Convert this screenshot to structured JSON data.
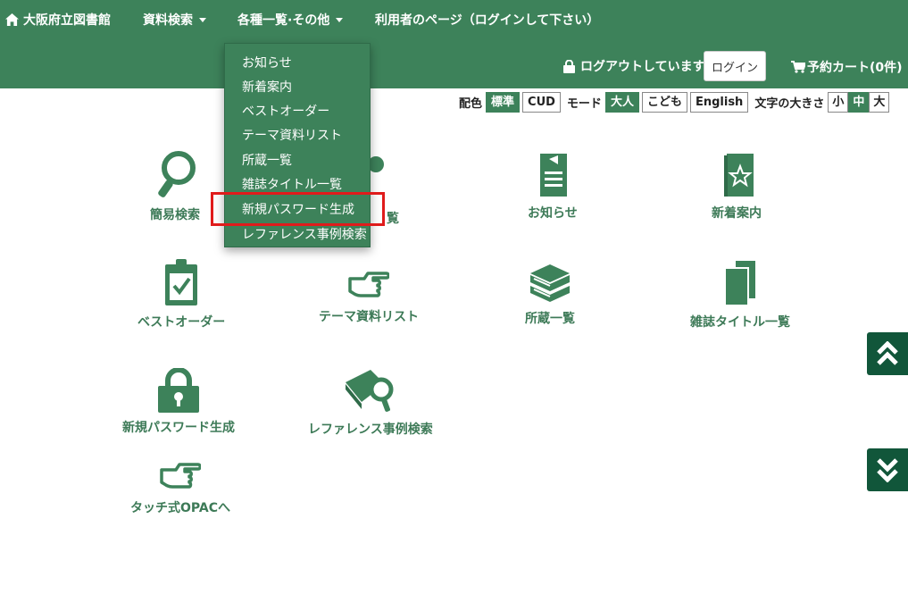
{
  "nav": {
    "home_label": "大阪府立図書館",
    "search_label": "資料検索",
    "lists_label": "各種一覧·その他",
    "user_page_label": "利用者のページ（ログインして下さい）"
  },
  "account": {
    "status_label": "ログアウトしています",
    "login_label": "ログイン",
    "cart_label": "予約カート(0件)"
  },
  "settings": {
    "color_label": "配色",
    "color_options": [
      "標準",
      "CUD"
    ],
    "color_selected": "標準",
    "mode_label": "モード",
    "mode_options": [
      "大人",
      "こども",
      "English"
    ],
    "mode_selected": "大人",
    "size_label": "文字の大きさ",
    "size_options": [
      "小",
      "中",
      "大"
    ],
    "size_selected": "中"
  },
  "dropdown": {
    "items": [
      "お知らせ",
      "新着案内",
      "ベストオーダー",
      "テーマ資料リスト",
      "所蔵一覧",
      "雑誌タイトル一覧",
      "新規パスワード生成",
      "レファレンス事例検索"
    ],
    "highlighted": "新規パスワード生成"
  },
  "tiles": {
    "simple_search": "簡易検索",
    "partial_hidden": "覧",
    "news": "お知らせ",
    "new_arrivals": "新着案内",
    "best_order": "ベストオーダー",
    "theme_list": "テーマ資料リスト",
    "holdings": "所蔵一覧",
    "magazine_titles": "雑誌タイトル一覧",
    "new_password": "新規パスワード生成",
    "reference_search": "レファレンス事例検索",
    "touch_opac": "タッチ式OPACへ"
  },
  "colors": {
    "primary": "#3d825a",
    "scroll_button": "#11563a",
    "highlight_border": "#e01b1b"
  },
  "icons": {
    "scroll_top": "double-chevron-up-icon",
    "scroll_bottom": "double-chevron-down-icon"
  }
}
